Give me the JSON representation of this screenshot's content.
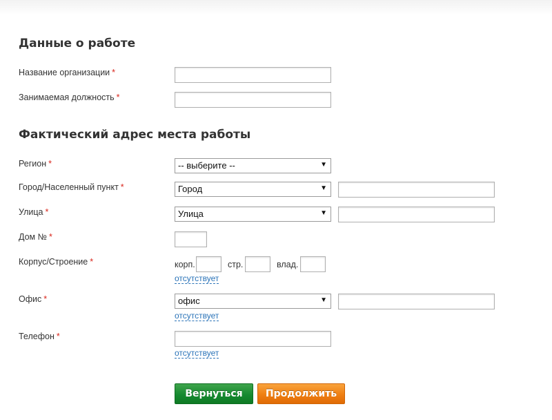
{
  "work_section": {
    "title": "Данные о работе",
    "org_label": "Название организации",
    "position_label": "Занимаемая должность"
  },
  "address_section": {
    "title": "Фактический адрес места работы",
    "region_label": "Регион",
    "region_value": "-- выберите --",
    "city_label": "Город/Населенный пункт",
    "city_type_value": "Город",
    "street_label": "Улица",
    "street_type_value": "Улица",
    "house_label": "Дом №",
    "building_label": "Корпус/Строение",
    "korp_label": "корп.",
    "str_label": "стр.",
    "vlad_label": "влад.",
    "office_label": "Офис",
    "office_type_value": "офис",
    "phone_label": "Телефон",
    "absent_link": "отсутствует"
  },
  "required_mark": "*",
  "buttons": {
    "back": "Вернуться",
    "next": "Продолжить"
  },
  "colors": {
    "required": "#d9261c",
    "link": "#2a73b8",
    "back_button": "#168a30",
    "next_button": "#ef7f12"
  }
}
